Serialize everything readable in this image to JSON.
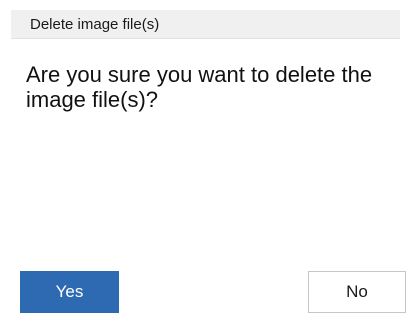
{
  "dialog": {
    "title": "Delete image file(s)",
    "message": "Are you sure you want to delete the image file(s)?",
    "yes_label": "Yes",
    "no_label": "No"
  },
  "colors": {
    "primary_button": "#2d6ab2",
    "title_bar": "#f0f0f0"
  }
}
